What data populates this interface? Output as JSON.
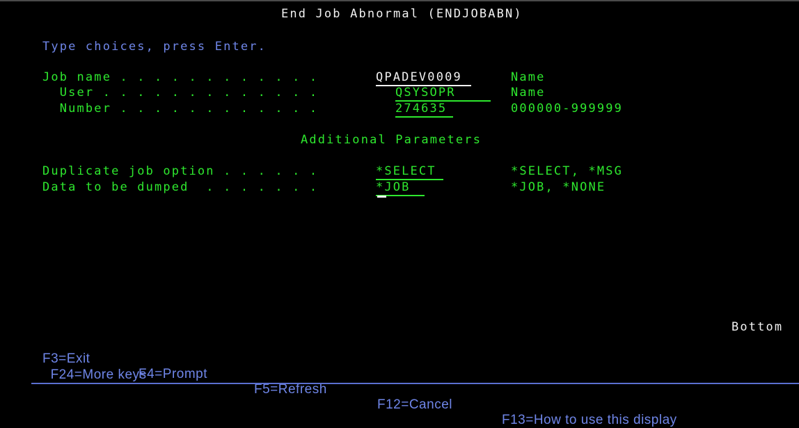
{
  "screen": {
    "title": "End Job Abnormal (ENDJOBABN)",
    "instruction": "Type choices, press Enter.",
    "section_heading": "Additional Parameters",
    "scroll_indicator": "Bottom"
  },
  "fields": [
    {
      "label": "Job name . . . . . . . . . . . .",
      "value": "QPADEV0009",
      "hint": "Name"
    },
    {
      "label": "  User . . . . . . . . . . . . .",
      "value": "QSYSOPR",
      "hint": "Name"
    },
    {
      "label": "  Number . . . . . . . . . . . .",
      "value": "274635",
      "hint": "000000-999999"
    }
  ],
  "additional_fields": [
    {
      "label": "Duplicate job option . . . . . .",
      "value": "*SELECT",
      "hint": "*SELECT, *MSG"
    },
    {
      "label": "Data to be dumped  . . . . . . .",
      "value": "*JOB",
      "hint": "*JOB, *NONE"
    }
  ],
  "function_keys": [
    {
      "label": "F3=Exit"
    },
    {
      "label": "F4=Prompt"
    },
    {
      "label": "F5=Refresh"
    },
    {
      "label": "F12=Cancel"
    },
    {
      "label": "F13=How to use this display"
    },
    {
      "label": "F24=More keys"
    }
  ],
  "colors": {
    "background": "#000000",
    "protected_text": "#2ee82e",
    "instruction_text": "#6f86e8",
    "title_text": "#f2f2f2"
  }
}
